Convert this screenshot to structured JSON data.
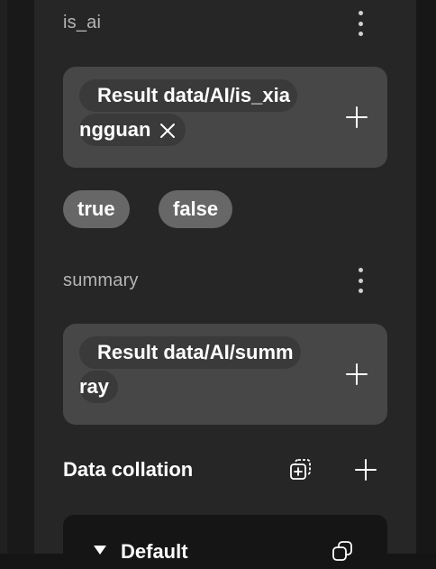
{
  "fields": [
    {
      "label": "is_ai",
      "token_line1": "Result data/AI/is_xia",
      "token_line2": "ngguan",
      "options": [
        "true",
        "false"
      ]
    },
    {
      "label": "summary",
      "token_line1": "Result data/AI/summ",
      "token_line2": "ray"
    }
  ],
  "data_collation": {
    "title": "Data collation",
    "group_name": "Default"
  },
  "colors": {
    "panel": "#262626",
    "token_box": "#474747",
    "chip": "#676767"
  }
}
